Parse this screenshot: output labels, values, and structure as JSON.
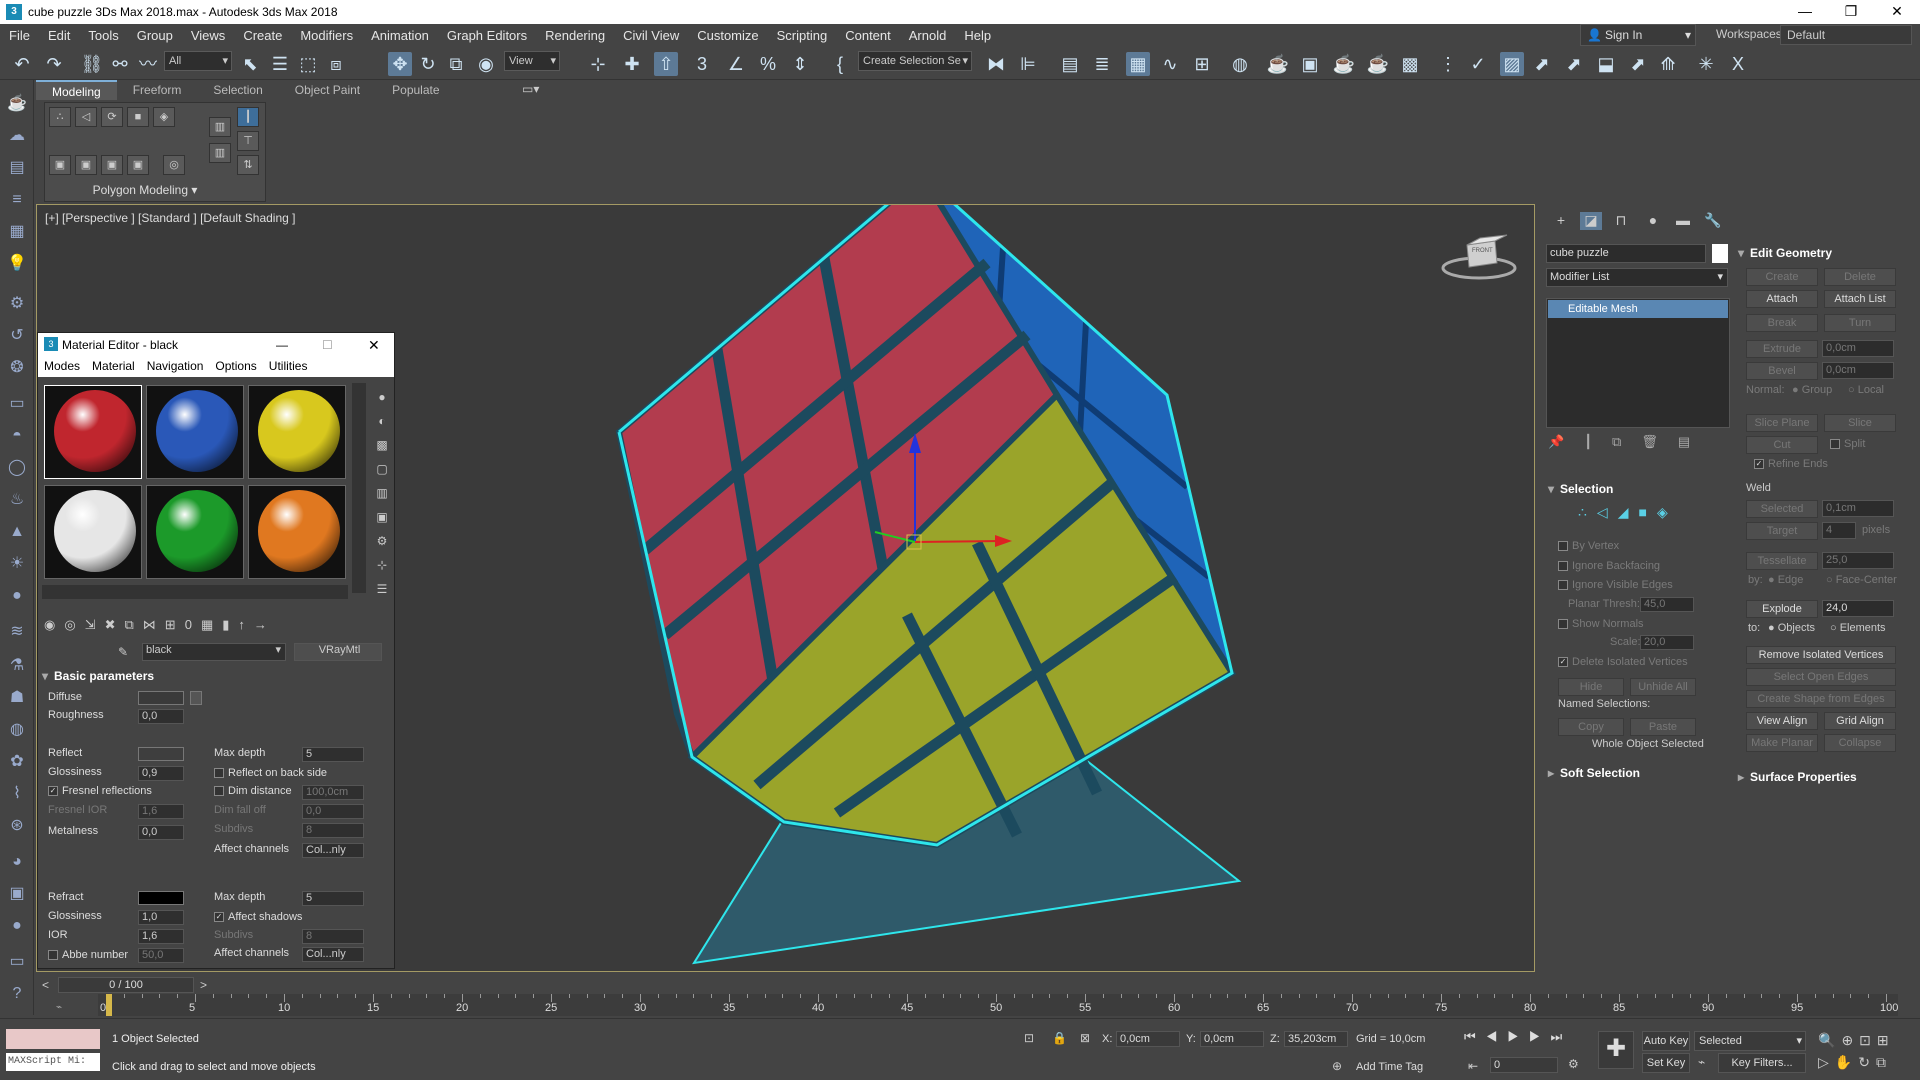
{
  "window": {
    "title": "cube puzzle 3Ds Max 2018.max - Autodesk 3ds Max 2018",
    "app_icon": "3",
    "minimize": "—",
    "restore": "❐",
    "close": "✕"
  },
  "menubar": [
    "File",
    "Edit",
    "Tools",
    "Group",
    "Views",
    "Create",
    "Modifiers",
    "Animation",
    "Graph Editors",
    "Rendering",
    "Civil View",
    "Customize",
    "Scripting",
    "Content",
    "Arnold",
    "Help"
  ],
  "account": {
    "sign_in": "Sign In",
    "workspaces_label": "Workspaces:",
    "workspace": "Default"
  },
  "toolbar": {
    "filter": "All",
    "ref_coord": "View",
    "selection_set": "Create Selection Se"
  },
  "ribbon": {
    "tabs": [
      "Modeling",
      "Freeform",
      "Selection",
      "Object Paint",
      "Populate"
    ],
    "active_tab": "Modeling",
    "panel_label": "Polygon Modeling"
  },
  "viewport": {
    "label": "[+] [Perspective ] [Standard ] [Default Shading ]",
    "viewcube_label": "FRONT"
  },
  "material_editor": {
    "title": "Material Editor - black",
    "menu": [
      "Modes",
      "Material",
      "Navigation",
      "Options",
      "Utilities"
    ],
    "slot_colors": [
      "#c0262e",
      "#2a58b8",
      "#d8c81e",
      "#e6e6e6",
      "#1c9a2a",
      "#e07820"
    ],
    "material_name": "black",
    "material_type": "VRayMtl",
    "section": "Basic parameters",
    "params": {
      "diffuse": "Diffuse",
      "roughness": "Roughness",
      "roughness_val": "0,0",
      "reflect": "Reflect",
      "max_depth": "Max depth",
      "max_depth_val": "5",
      "glossiness": "Glossiness",
      "glossiness_val": "0,9",
      "reflect_back": "Reflect on back side",
      "fresnel": "Fresnel reflections",
      "dim_distance": "Dim distance",
      "dim_distance_val": "100,0cm",
      "fresnel_ior": "Fresnel IOR",
      "fresnel_ior_val": "1,6",
      "dim_falloff": "Dim fall off",
      "dim_falloff_val": "0,0",
      "subdivs": "Subdivs",
      "subdivs_val": "8",
      "metalness": "Metalness",
      "metalness_val": "0,0",
      "affect_channels": "Affect channels",
      "affect_val": "Col...nly",
      "refract": "Refract",
      "refract_max_depth_val": "5",
      "refract_gloss_val": "1,0",
      "affect_shadows": "Affect shadows",
      "ior": "IOR",
      "ior_val": "1,6",
      "refract_subdivs_val": "8",
      "abbe": "Abbe number",
      "abbe_val": "50,0"
    }
  },
  "command_panel": {
    "object_name": "cube puzzle",
    "modifier_list": "Modifier List",
    "stack_item": "Editable Mesh",
    "selection": {
      "title": "Selection",
      "by_vertex": "By Vertex",
      "ignore_backfacing": "Ignore Backfacing",
      "ignore_visible": "Ignore Visible Edges",
      "planar_thresh": "Planar Thresh:",
      "planar_val": "45,0",
      "show_normals": "Show Normals",
      "scale": "Scale:",
      "scale_val": "20,0",
      "delete_isolated": "Delete Isolated Vertices",
      "hide": "Hide",
      "unhide_all": "Unhide All",
      "named_selections": "Named Selections:",
      "copy": "Copy",
      "paste": "Paste",
      "status": "Whole Object Selected"
    },
    "soft_selection": "Soft Selection",
    "edit_geometry": {
      "title": "Edit Geometry",
      "create": "Create",
      "delete": "Delete",
      "attach": "Attach",
      "attach_list": "Attach List",
      "break": "Break",
      "turn": "Turn",
      "extrude": "Extrude",
      "extrude_val": "0,0cm",
      "bevel": "Bevel",
      "bevel_val": "0,0cm",
      "normal": "Normal:",
      "group": "Group",
      "local": "Local",
      "slice_plane": "Slice Plane",
      "slice": "Slice",
      "cut": "Cut",
      "split": "Split",
      "refine_ends": "Refine Ends",
      "weld": "Weld",
      "selected": "Selected",
      "selected_val": "0,1cm",
      "target": "Target",
      "target_val": "4",
      "pixels": "pixels",
      "tessellate": "Tessellate",
      "tessellate_val": "25,0",
      "by": "by:",
      "edge": "Edge",
      "face_center": "Face-Center",
      "explode": "Explode",
      "explode_val": "24,0",
      "to": "to:",
      "objects": "Objects",
      "elements": "Elements",
      "remove_isolated": "Remove Isolated Vertices",
      "select_open_edges": "Select Open Edges",
      "create_shape": "Create Shape from Edges",
      "view_align": "View Align",
      "grid_align": "Grid Align",
      "make_planar": "Make Planar",
      "collapse": "Collapse"
    },
    "surface_properties": "Surface Properties"
  },
  "timeline": {
    "frame": "0 / 100",
    "ticks": [
      "0",
      "5",
      "10",
      "15",
      "20",
      "25",
      "30",
      "35",
      "40",
      "45",
      "50",
      "55",
      "60",
      "65",
      "70",
      "75",
      "80",
      "85",
      "90",
      "95",
      "100"
    ]
  },
  "status": {
    "maxscript": "MAXScript Mi:",
    "objects_selected": "1 Object Selected",
    "prompt": "Click and drag to select and move objects",
    "x_label": "X:",
    "x": "0,0cm",
    "y_label": "Y:",
    "y": "0,0cm",
    "z_label": "Z:",
    "z": "35,203cm",
    "grid": "Grid = 10,0cm",
    "add_time_tag": "Add Time Tag",
    "auto_key": "Auto Key",
    "set_key": "Set Key",
    "key_mode": "Selected",
    "key_filters": "Key Filters...",
    "current_frame": "0"
  }
}
